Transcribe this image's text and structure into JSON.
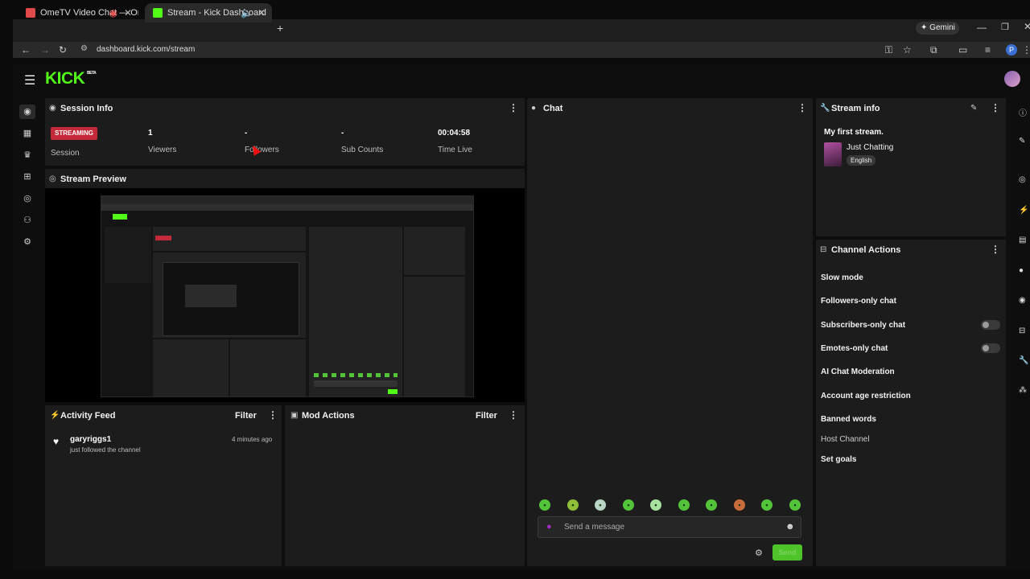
{
  "browser": {
    "tabs": [
      {
        "title": "OmeTV Video Chat — Ome",
        "active": false
      },
      {
        "title": "Stream - Kick Dashboard",
        "active": true
      }
    ],
    "new_tab": "+",
    "gemini_label": "Gemini",
    "url": "dashboard.kick.com/stream",
    "profile_initial": "P"
  },
  "header": {
    "logo": "KICK",
    "logo_badge": "BETA"
  },
  "session_info": {
    "title": "Session Info",
    "status_badge": "STREAMING",
    "session_label": "Session",
    "stats": [
      {
        "value": "1",
        "label": "Viewers"
      },
      {
        "value": "-",
        "label": "Followers"
      },
      {
        "value": "-",
        "label": "Sub Counts"
      },
      {
        "value": "00:04:58",
        "label": "Time Live"
      }
    ]
  },
  "stream_preview": {
    "title": "Stream Preview"
  },
  "activity_feed": {
    "title": "Activity Feed",
    "filter": "Filter",
    "items": [
      {
        "user": "garyriggs1",
        "text": "just followed the channel",
        "time": "4 minutes ago"
      }
    ]
  },
  "mod_actions": {
    "title": "Mod Actions",
    "filter": "Filter"
  },
  "chat": {
    "title": "Chat",
    "placeholder": "Send a message",
    "send_label": "Send"
  },
  "stream_info": {
    "title": "Stream info",
    "stream_title": "My first stream.",
    "category": "Just Chatting",
    "language": "English"
  },
  "channel_actions": {
    "title": "Channel Actions",
    "items": [
      {
        "label": "Slow mode",
        "toggle": false
      },
      {
        "label": "Followers-only chat",
        "toggle": false
      },
      {
        "label": "Subscribers-only chat",
        "toggle": true
      },
      {
        "label": "Emotes-only chat",
        "toggle": true
      },
      {
        "label": "AI Chat Moderation",
        "toggle": false
      },
      {
        "label": "Account age restriction",
        "toggle": false
      },
      {
        "label": "Banned words",
        "toggle": false
      },
      {
        "label": "Host Channel",
        "toggle": false
      },
      {
        "label": "Set goals",
        "toggle": false
      }
    ]
  },
  "colors": {
    "accent": "#53fc18",
    "streaming_badge": "#c42a3a",
    "panel": "#1c1c1c",
    "background": "#0e0e0e"
  }
}
